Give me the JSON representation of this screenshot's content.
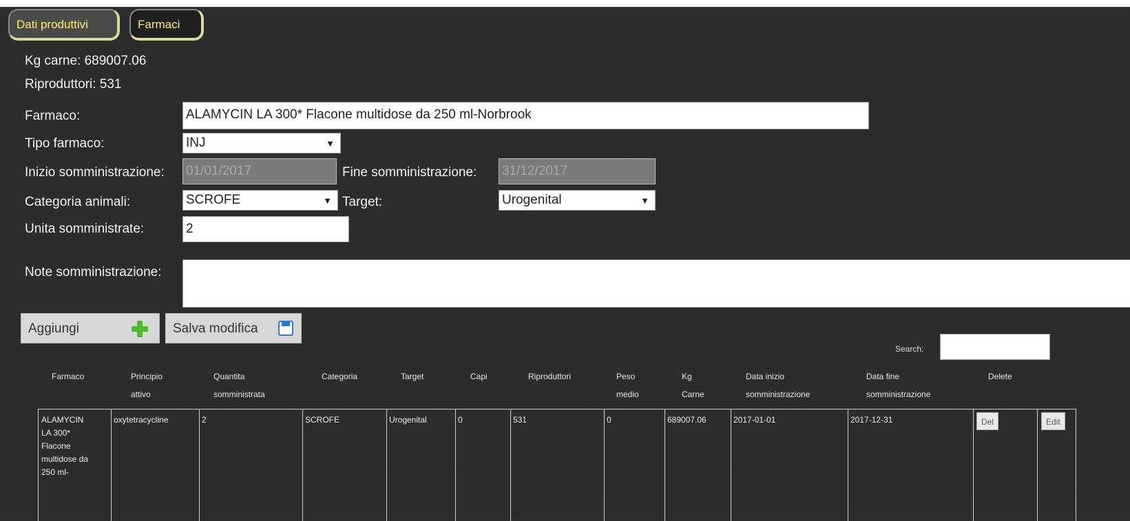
{
  "tabs": [
    {
      "label": "Dati produttivi"
    },
    {
      "label": "Farmaci"
    }
  ],
  "summary": {
    "kg_carne": "Kg carne: 689007.06",
    "riproduttori": "Riproduttori: 531"
  },
  "form": {
    "farmaco_label": "Farmaco:",
    "farmaco_value": "ALAMYCIN LA 300* Flacone multidose da 250 ml-Norbrook",
    "tipo_label": "Tipo farmaco:",
    "tipo_value": "INJ",
    "inizio_label": "Inizio somministrazione:",
    "inizio_value": "01/01/2017",
    "fine_label": "Fine somministrazione:",
    "fine_value": "31/12/2017",
    "categoria_label": "Categoria animali:",
    "categoria_value": "SCROFE",
    "target_label": "Target:",
    "target_value": "Urogenital",
    "unita_label": "Unita somministrate:",
    "unita_value": "2",
    "note_label": "Note somministrazione:",
    "note_value": ""
  },
  "actions": {
    "aggiungi": "Aggiungi",
    "salva": "Salva modifica"
  },
  "search": {
    "label": "Search:",
    "value": ""
  },
  "table": {
    "headers": [
      [
        "Farmaco",
        ""
      ],
      [
        "Principio",
        "attivo"
      ],
      [
        "Quantita",
        "somministrata"
      ],
      [
        "Categoria",
        ""
      ],
      [
        "Target",
        ""
      ],
      [
        "Capi",
        ""
      ],
      [
        "Riproduttori",
        ""
      ],
      [
        "Peso",
        "medio"
      ],
      [
        "Kg",
        "Carne"
      ],
      [
        "Data inizio",
        "somministrazione"
      ],
      [
        "Data fine",
        "somministrazione"
      ],
      [
        "Delete",
        ""
      ]
    ],
    "row": {
      "farmaco": [
        "ALAMYCIN",
        "LA 300*",
        "Flacone",
        "multidose da",
        "250 ml-"
      ],
      "principio": "oxytetracycline",
      "quantita": "2",
      "categoria": "SCROFE",
      "target": "Urogenital",
      "capi": "0",
      "riproduttori": "531",
      "peso": "0",
      "kg": "689007.06",
      "data_inizio": "2017-01-01",
      "data_fine": "2017-12-31",
      "del": "Del",
      "edit": "Edit"
    }
  }
}
